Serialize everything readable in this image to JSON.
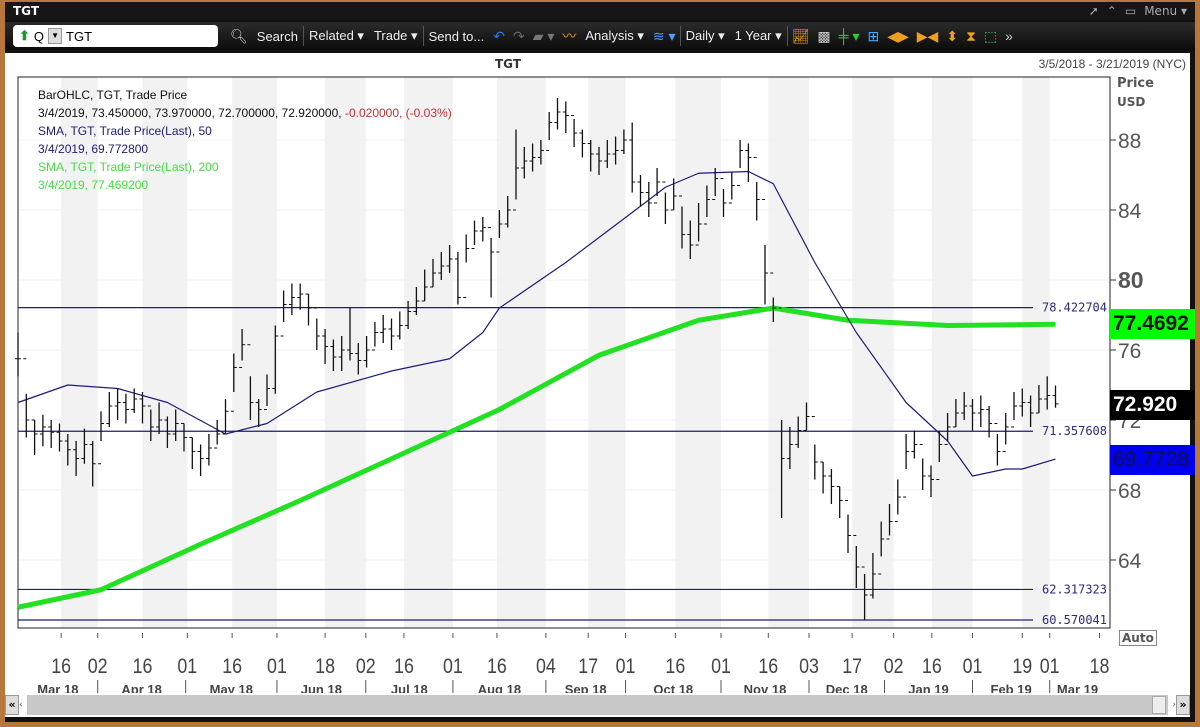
{
  "window": {
    "title": "TGT",
    "menu_label": "Menu ▾"
  },
  "toolbar": {
    "symbol_prefix": "Q",
    "symbol_value": "TGT",
    "search": "Search",
    "related": "Related ▾",
    "trade": "Trade ▾",
    "send_to": "Send to...",
    "analysis": "Analysis ▾",
    "interval": "Daily ▾",
    "range": "1 Year ▾"
  },
  "chart_header": {
    "title": "TGT",
    "date_range": "3/5/2018 - 3/21/2019 (NYC)"
  },
  "legend": {
    "l1": "BarOHLC, TGT, Trade Price",
    "l2": "3/4/2019, 73.450000, 73.970000, 72.700000, 72.920000,",
    "l2_change": "-0.020000, (-0.03%)",
    "l3": "SMA, TGT, Trade Price(Last),  50",
    "l4": "3/4/2019, 69.772800",
    "l5": "SMA, TGT, Trade Price(Last),  200",
    "l6": "3/4/2019, 77.469200"
  },
  "axis": {
    "title1": "Price",
    "title2": "USD",
    "auto": "Auto"
  },
  "price_tags": {
    "sma200": "77.4692",
    "last": "72.920",
    "sma50": "69.7728"
  },
  "colors": {
    "sma50": "#1c1c7a",
    "sma200": "#22e022",
    "hline": "#1c1c7a",
    "tag_sma200": "#00ff00",
    "tag_last": "#000000",
    "tag_sma50": "#0000ff",
    "change": "#c03030"
  },
  "chart_data": {
    "type": "ohlc",
    "title": "TGT",
    "ylabel": "Price USD",
    "ylim": [
      60,
      91.5
    ],
    "yticks": [
      64,
      68,
      72,
      76,
      80,
      84,
      88
    ],
    "hlines": [
      "78.422704",
      "71.357608",
      "62.317323",
      "60.570041"
    ],
    "xticks": [
      [
        "16",
        5.2
      ],
      [
        "02",
        9.6
      ],
      [
        "16",
        15
      ],
      [
        "01",
        20.4
      ],
      [
        "16",
        25.8
      ],
      [
        "01",
        31.2
      ],
      [
        "18",
        37
      ],
      [
        "02",
        41.9
      ],
      [
        "16",
        46.5
      ],
      [
        "01",
        52.4
      ],
      [
        "16",
        57.7
      ],
      [
        "04",
        63.6
      ],
      [
        "17",
        68.7
      ],
      [
        "01",
        73.2
      ],
      [
        "16",
        79.2
      ],
      [
        "01",
        84.7
      ],
      [
        "16",
        90.4
      ],
      [
        "03",
        95.3
      ],
      [
        "17",
        100.5
      ],
      [
        "02",
        105.5
      ],
      [
        "16",
        110.1
      ],
      [
        "01",
        115
      ],
      [
        "19",
        121
      ],
      [
        "01",
        124.3
      ],
      [
        "18",
        130.3
      ]
    ],
    "months": [
      [
        "Mar 18",
        -2,
        9.6
      ],
      [
        "Apr 18",
        9.6,
        20.2
      ],
      [
        "May 18",
        20.2,
        31.2
      ],
      [
        "Jun 18",
        31.2,
        41.9
      ],
      [
        "Jul 18",
        41.9,
        52.4
      ],
      [
        "Aug 18",
        52.4,
        63.6
      ],
      [
        "Sep 18",
        63.6,
        73.2
      ],
      [
        "Oct 18",
        73.2,
        84.7
      ],
      [
        "Nov 18",
        84.7,
        95.3
      ],
      [
        "Dec 18",
        95.3,
        104.4
      ],
      [
        "Jan 19",
        104.4,
        115
      ],
      [
        "Feb 19",
        115,
        124.3
      ],
      [
        "Mar 19",
        124.3,
        131
      ]
    ],
    "bars_hlc": [
      [
        77,
        74.5,
        75.5
      ],
      [
        73.5,
        71,
        72
      ],
      [
        72,
        70,
        71.2
      ],
      [
        72.3,
        70.5,
        71.6
      ],
      [
        72,
        70.4,
        71.3
      ],
      [
        71.8,
        70.2,
        70.8
      ],
      [
        71.2,
        69.4,
        70.3
      ],
      [
        70.8,
        68.8,
        69.8
      ],
      [
        71.5,
        69.5,
        70.6
      ],
      [
        70.8,
        68.2,
        69.5
      ],
      [
        72.5,
        70.8,
        71.8
      ],
      [
        73.6,
        71.6,
        72.8
      ],
      [
        73.8,
        72,
        73
      ],
      [
        73.5,
        71.8,
        72.6
      ],
      [
        73.8,
        72.4,
        73.2
      ],
      [
        73.6,
        71.8,
        72.8
      ],
      [
        72.6,
        70.8,
        71.6
      ],
      [
        73,
        71.2,
        72
      ],
      [
        72.2,
        70.4,
        71.2
      ],
      [
        72.6,
        70.8,
        71.8
      ],
      [
        71.8,
        70.2,
        71
      ],
      [
        71,
        69.2,
        70.2
      ],
      [
        70.6,
        68.8,
        69.8
      ],
      [
        71.2,
        69.4,
        70.4
      ],
      [
        72,
        70.6,
        71.2
      ],
      [
        73.2,
        71.2,
        72.5
      ],
      [
        75.8,
        73.6,
        75
      ],
      [
        77.2,
        75.4,
        76.3
      ],
      [
        74.5,
        72,
        73
      ],
      [
        73.2,
        71.6,
        72.6
      ],
      [
        74.6,
        72.8,
        73.8
      ],
      [
        77.4,
        73.5,
        76.8
      ],
      [
        79.4,
        77.6,
        78.6
      ],
      [
        79.8,
        78,
        79
      ],
      [
        79.8,
        78.3,
        79.2
      ],
      [
        79.2,
        77.4,
        78.4
      ],
      [
        77.8,
        76,
        76.8
      ],
      [
        77.2,
        75.2,
        76.2
      ],
      [
        76.6,
        74.8,
        75.6
      ],
      [
        76.8,
        74.8,
        76
      ],
      [
        78.4,
        75.4,
        75.8
      ],
      [
        76.4,
        74.6,
        75.4
      ],
      [
        76.8,
        75,
        76
      ],
      [
        77.6,
        76.2,
        77
      ],
      [
        78,
        76.4,
        77.2
      ],
      [
        77.8,
        76,
        76.8
      ],
      [
        78.2,
        76.6,
        77.4
      ],
      [
        78.8,
        77.2,
        78.2
      ],
      [
        79.6,
        78,
        78.8
      ],
      [
        80.6,
        78.8,
        79.6
      ],
      [
        81.2,
        79.6,
        80.4
      ],
      [
        81.6,
        80,
        80.8
      ],
      [
        82,
        80.4,
        81.2
      ],
      [
        81.6,
        78.6,
        79
      ],
      [
        82.6,
        81,
        81.8
      ],
      [
        83.4,
        82,
        82.8
      ],
      [
        83.6,
        82.2,
        83
      ],
      [
        82.4,
        79,
        81.6
      ],
      [
        84,
        82.4,
        83.2
      ],
      [
        84.8,
        83,
        84
      ],
      [
        88.6,
        84.6,
        86.4
      ],
      [
        87.6,
        85.8,
        86.8
      ],
      [
        87.8,
        86.2,
        87
      ],
      [
        88,
        86.6,
        87.4
      ],
      [
        89.6,
        88,
        89
      ],
      [
        90.4,
        88.6,
        89.6
      ],
      [
        90.2,
        88.4,
        89.4
      ],
      [
        89.2,
        87.6,
        88.4
      ],
      [
        88.6,
        87,
        87.8
      ],
      [
        88,
        86.2,
        87.2
      ],
      [
        87.6,
        86,
        86.8
      ],
      [
        88,
        86.4,
        87.2
      ],
      [
        88.2,
        86.6,
        87.4
      ],
      [
        88.6,
        87.2,
        88
      ],
      [
        89,
        85,
        85.6
      ],
      [
        86,
        84.2,
        85
      ],
      [
        85.6,
        83.6,
        84.4
      ],
      [
        86.4,
        84.8,
        85.6
      ],
      [
        85,
        83.2,
        84
      ],
      [
        85.8,
        84,
        84.8
      ],
      [
        84.2,
        81.8,
        82.6
      ],
      [
        83.4,
        81.2,
        82
      ],
      [
        84.4,
        82.2,
        83.2
      ],
      [
        85.4,
        83.6,
        84.6
      ],
      [
        86.4,
        84.8,
        85.8
      ],
      [
        85.2,
        83.6,
        84.4
      ],
      [
        86.2,
        84.6,
        85.4
      ],
      [
        88,
        86.4,
        87.4
      ],
      [
        87.8,
        85.6,
        87
      ],
      [
        85.6,
        83.4,
        84.6
      ],
      [
        82,
        78.6,
        80.4
      ],
      [
        79,
        77.6,
        78.4
      ],
      [
        72,
        66.4,
        69.8
      ],
      [
        71.6,
        69.2,
        70.6
      ],
      [
        72.2,
        70.4,
        71.4
      ],
      [
        73,
        71.4,
        72.2
      ],
      [
        70.6,
        68.6,
        69.6
      ],
      [
        69.6,
        67.8,
        68.8
      ],
      [
        69.2,
        67.2,
        68.2
      ],
      [
        68.2,
        66.4,
        67.4
      ],
      [
        66.6,
        64.4,
        65.4
      ],
      [
        64.8,
        62.4,
        63.6
      ],
      [
        63.2,
        60.6,
        62
      ],
      [
        64.4,
        61.8,
        63.2
      ],
      [
        66.2,
        64.2,
        65.2
      ],
      [
        67.2,
        65.4,
        66.2
      ],
      [
        68.6,
        66.6,
        67.6
      ],
      [
        71.2,
        69.2,
        70.2
      ],
      [
        71.4,
        69.8,
        70.6
      ],
      [
        69.8,
        68,
        68.8
      ],
      [
        69.4,
        67.6,
        68.6
      ],
      [
        71.4,
        69.6,
        70.6
      ],
      [
        72.4,
        70.8,
        71.6
      ],
      [
        73.2,
        71.6,
        72.4
      ],
      [
        73.6,
        72,
        72.8
      ],
      [
        73.2,
        71.4,
        72.4
      ],
      [
        73.4,
        71.6,
        72.6
      ],
      [
        72.8,
        71,
        71.8
      ],
      [
        71.2,
        69.4,
        70.2
      ],
      [
        72.4,
        70.6,
        71.6
      ],
      [
        73.6,
        72,
        72.8
      ],
      [
        73.8,
        72.2,
        73
      ],
      [
        73.4,
        71.6,
        72.4
      ],
      [
        74,
        72.4,
        73.2
      ],
      [
        74.5,
        72.6,
        73.4
      ],
      [
        73.97,
        72.7,
        72.92
      ]
    ],
    "sma50": [
      [
        0,
        73
      ],
      [
        6,
        74
      ],
      [
        12,
        73.8
      ],
      [
        18,
        73
      ],
      [
        25,
        71.2
      ],
      [
        30,
        71.8
      ],
      [
        36,
        73.6
      ],
      [
        45,
        74.8
      ],
      [
        52,
        75.5
      ],
      [
        56,
        77
      ],
      [
        58,
        78.4
      ],
      [
        66,
        81
      ],
      [
        73,
        83.5
      ],
      [
        78,
        85.3
      ],
      [
        82,
        86.1
      ],
      [
        88,
        86.2
      ],
      [
        91,
        85.5
      ],
      [
        96,
        81
      ],
      [
        101,
        77
      ],
      [
        107,
        73
      ],
      [
        112,
        70.8
      ],
      [
        115,
        68.8
      ],
      [
        119,
        69.2
      ],
      [
        121,
        69.2
      ],
      [
        125,
        69.77
      ]
    ],
    "sma200": [
      [
        0,
        61.3
      ],
      [
        10,
        62.3
      ],
      [
        22,
        64.9
      ],
      [
        34,
        67.4
      ],
      [
        46,
        70
      ],
      [
        58,
        72.6
      ],
      [
        70,
        75.7
      ],
      [
        82,
        77.7
      ],
      [
        91,
        78.4
      ],
      [
        100,
        77.7
      ],
      [
        112,
        77.4
      ],
      [
        125,
        77.47
      ]
    ]
  }
}
